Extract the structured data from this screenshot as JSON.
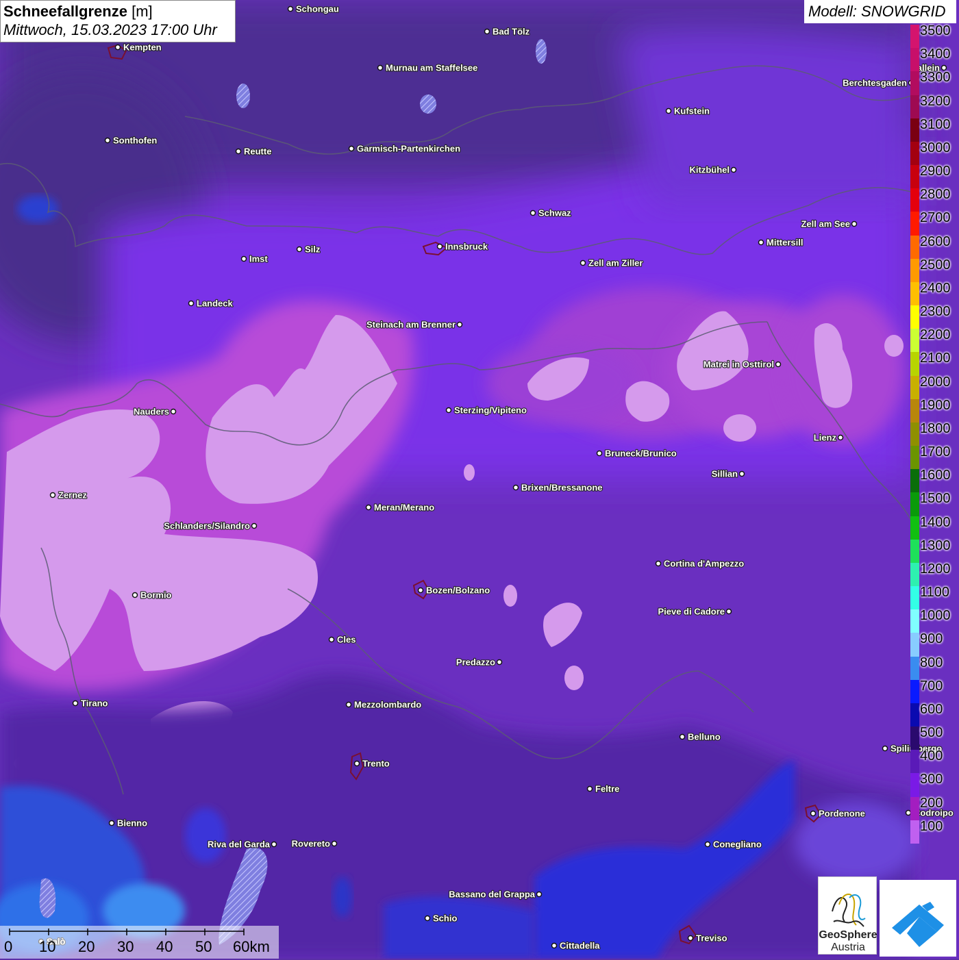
{
  "title": {
    "parameter": "Schneefallgrenze",
    "unit": "[m]",
    "datetime": "Mittwoch, 15.03.2023 17:00 Uhr"
  },
  "model": "Modell: SNOWGRID",
  "legend": {
    "values": [
      {
        "label": "3500",
        "color": "#d4146e"
      },
      {
        "label": "3400",
        "color": "#c70f6a"
      },
      {
        "label": "3300",
        "color": "#b20c5f"
      },
      {
        "label": "3200",
        "color": "#9e0a52"
      },
      {
        "label": "3100",
        "color": "#7a0012"
      },
      {
        "label": "3000",
        "color": "#a30010"
      },
      {
        "label": "2900",
        "color": "#c8000e"
      },
      {
        "label": "2800",
        "color": "#e4000c"
      },
      {
        "label": "2700",
        "color": "#ff1a00"
      },
      {
        "label": "2600",
        "color": "#ff6a00"
      },
      {
        "label": "2500",
        "color": "#ff9a00"
      },
      {
        "label": "2400",
        "color": "#ffbf00"
      },
      {
        "label": "2300",
        "color": "#ffff00"
      },
      {
        "label": "2200",
        "color": "#ccff33"
      },
      {
        "label": "2100",
        "color": "#b8d400"
      },
      {
        "label": "2000",
        "color": "#c8b000"
      },
      {
        "label": "1900",
        "color": "#b8860b"
      },
      {
        "label": "1800",
        "color": "#8f8f00"
      },
      {
        "label": "1700",
        "color": "#6b9400"
      },
      {
        "label": "1600",
        "color": "#0a6e0a"
      },
      {
        "label": "1500",
        "color": "#0a9a0a"
      },
      {
        "label": "1400",
        "color": "#11bf11"
      },
      {
        "label": "1300",
        "color": "#1ee05a"
      },
      {
        "label": "1200",
        "color": "#2ef0b0"
      },
      {
        "label": "1100",
        "color": "#33ffe6"
      },
      {
        "label": "1000",
        "color": "#80ffff"
      },
      {
        "label": "900",
        "color": "#88ccff"
      },
      {
        "label": "800",
        "color": "#3a8cf0"
      },
      {
        "label": "700",
        "color": "#0a1aff"
      },
      {
        "label": "600",
        "color": "#0a0ab0"
      },
      {
        "label": "500",
        "color": "#2a0a6e"
      },
      {
        "label": "400",
        "color": "#5a1ab8"
      },
      {
        "label": "300",
        "color": "#7a1ae6"
      },
      {
        "label": "200",
        "color": "#a31ec0"
      },
      {
        "label": "100",
        "color": "#c060f0"
      }
    ]
  },
  "scale_bar": {
    "ticks": [
      "0",
      "10",
      "20",
      "30",
      "40",
      "50",
      "60km"
    ]
  },
  "logo": {
    "brand_line1": "GeoSphere",
    "brand_line2": "Austria"
  },
  "cities": [
    {
      "name": "Schongau",
      "anchor": "left"
    },
    {
      "name": "Bad Tölz",
      "anchor": "left"
    },
    {
      "name": "Kempten",
      "anchor": "left"
    },
    {
      "name": "Murnau am Staffelsee",
      "anchor": "left"
    },
    {
      "name": "Hallein",
      "anchor": "right"
    },
    {
      "name": "Berchtesgaden",
      "anchor": "right"
    },
    {
      "name": "Kufstein",
      "anchor": "left"
    },
    {
      "name": "Sonthofen",
      "anchor": "left"
    },
    {
      "name": "Reutte",
      "anchor": "left"
    },
    {
      "name": "Garmisch-Partenkirchen",
      "anchor": "left"
    },
    {
      "name": "Kitzbühel",
      "anchor": "right"
    },
    {
      "name": "Schwaz",
      "anchor": "left"
    },
    {
      "name": "Zell am See",
      "anchor": "right"
    },
    {
      "name": "Innsbruck",
      "anchor": "left"
    },
    {
      "name": "Mittersill",
      "anchor": "left"
    },
    {
      "name": "Imst",
      "anchor": "left"
    },
    {
      "name": "Silz",
      "anchor": "left"
    },
    {
      "name": "Zell am Ziller",
      "anchor": "left"
    },
    {
      "name": "Landeck",
      "anchor": "left"
    },
    {
      "name": "Steinach am Brenner",
      "anchor": "right"
    },
    {
      "name": "Matrei in Osttirol",
      "anchor": "right"
    },
    {
      "name": "Nauders",
      "anchor": "right"
    },
    {
      "name": "Sterzing/Vipiteno",
      "anchor": "left"
    },
    {
      "name": "Lienz",
      "anchor": "right"
    },
    {
      "name": "Bruneck/Brunico",
      "anchor": "left"
    },
    {
      "name": "Sillian",
      "anchor": "right"
    },
    {
      "name": "Zernez",
      "anchor": "left"
    },
    {
      "name": "Brixen/Bressanone",
      "anchor": "left"
    },
    {
      "name": "Meran/Merano",
      "anchor": "left"
    },
    {
      "name": "Schlanders/Silandro",
      "anchor": "right"
    },
    {
      "name": "Cortina d'Ampezzo",
      "anchor": "left"
    },
    {
      "name": "Bozen/Bolzano",
      "anchor": "left"
    },
    {
      "name": "Bormio",
      "anchor": "left"
    },
    {
      "name": "Pieve di Cadore",
      "anchor": "right"
    },
    {
      "name": "Cles",
      "anchor": "left"
    },
    {
      "name": "Predazzo",
      "anchor": "right"
    },
    {
      "name": "Tirano",
      "anchor": "left"
    },
    {
      "name": "Mezzolombardo",
      "anchor": "left"
    },
    {
      "name": "Belluno",
      "anchor": "left"
    },
    {
      "name": "Spilimbergo",
      "anchor": "left"
    },
    {
      "name": "Trento",
      "anchor": "left"
    },
    {
      "name": "Feltre",
      "anchor": "left"
    },
    {
      "name": "Pordenone",
      "anchor": "left"
    },
    {
      "name": "Codroipo",
      "anchor": "left"
    },
    {
      "name": "Bienno",
      "anchor": "left"
    },
    {
      "name": "Riva del Garda",
      "anchor": "right"
    },
    {
      "name": "Rovereto",
      "anchor": "right"
    },
    {
      "name": "Conegliano",
      "anchor": "left"
    },
    {
      "name": "Bassano del Grappa",
      "anchor": "right"
    },
    {
      "name": "Schio",
      "anchor": "left"
    },
    {
      "name": "Treviso",
      "anchor": "left"
    },
    {
      "name": "Cittadella",
      "anchor": "left"
    },
    {
      "name": "Salò",
      "anchor": "left"
    }
  ]
}
